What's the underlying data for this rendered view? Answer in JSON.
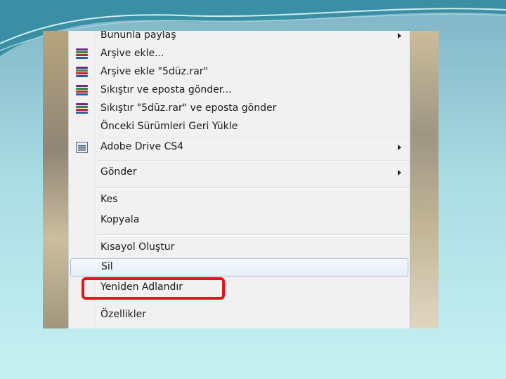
{
  "menu": {
    "items": [
      {
        "label": "Bununla paylaş",
        "submenu": true,
        "icon": ""
      },
      {
        "label": "Arşive ekle...",
        "submenu": false,
        "icon": "winrar-icon"
      },
      {
        "label": "Arşive ekle \"5düz.rar\"",
        "submenu": false,
        "icon": "winrar-icon"
      },
      {
        "label": "Sıkıştır ve eposta gönder...",
        "submenu": false,
        "icon": "winrar-icon"
      },
      {
        "label": "Sıkıştır \"5düz.rar\" ve eposta gönder",
        "submenu": false,
        "icon": "winrar-icon"
      },
      {
        "label": "Önceki Sürümleri Geri Yükle",
        "submenu": false,
        "icon": ""
      },
      {
        "label": "Adobe Drive CS4",
        "submenu": true,
        "icon": "adobe-drive-icon"
      },
      {
        "label": "Gönder",
        "submenu": true,
        "icon": ""
      },
      {
        "label": "Kes",
        "submenu": false,
        "icon": ""
      },
      {
        "label": "Kopyala",
        "submenu": false,
        "icon": ""
      },
      {
        "label": "Kısayol Oluştur",
        "submenu": false,
        "icon": ""
      },
      {
        "label": "Sil",
        "submenu": false,
        "icon": ""
      },
      {
        "label": "Yeniden Adlandır",
        "submenu": false,
        "icon": ""
      },
      {
        "label": "Özellikler",
        "submenu": false,
        "icon": ""
      }
    ],
    "hovered_item": "Sil",
    "highlighted_item": "Yeniden Adlandır"
  },
  "colors": {
    "menu_background": "#f1f1f1",
    "highlight_ring": "#e0161d",
    "hover_border": "#aebfd3",
    "slide_background": "#c6f1f3"
  }
}
